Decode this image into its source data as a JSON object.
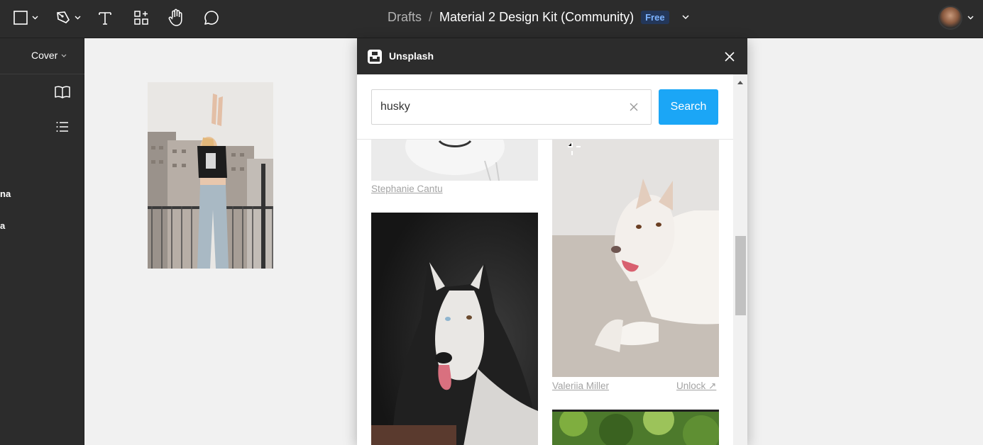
{
  "toolbar": {
    "tools": [
      {
        "name": "frame-tool",
        "icon": "frame-icon"
      },
      {
        "name": "pen-tool",
        "icon": "pen-icon"
      },
      {
        "name": "text-tool",
        "icon": "text-icon"
      },
      {
        "name": "resources-tool",
        "icon": "resources-icon"
      },
      {
        "name": "hand-tool",
        "icon": "hand-icon"
      },
      {
        "name": "comment-tool",
        "icon": "comment-icon"
      }
    ],
    "breadcrumb": {
      "folder": "Drafts",
      "separator": "/",
      "file": "Material 2 Design Kit (Community)",
      "badge": "Free"
    }
  },
  "left_panel": {
    "page_select": "Cover",
    "layers_partial": [
      "na",
      "a"
    ]
  },
  "plugin": {
    "title": "Unsplash",
    "search": {
      "value": "husky",
      "button": "Search"
    },
    "results": {
      "col1_credit_top": "Stephanie Cantu",
      "col2_credit": "Valeriia Miller",
      "col2_unlock": "Unlock ↗"
    }
  },
  "colors": {
    "toolbar_bg": "#2c2c2c",
    "canvas_bg": "#f1f1f1",
    "accent": "#1ba6f6",
    "badge_text": "#7cb3ff"
  }
}
